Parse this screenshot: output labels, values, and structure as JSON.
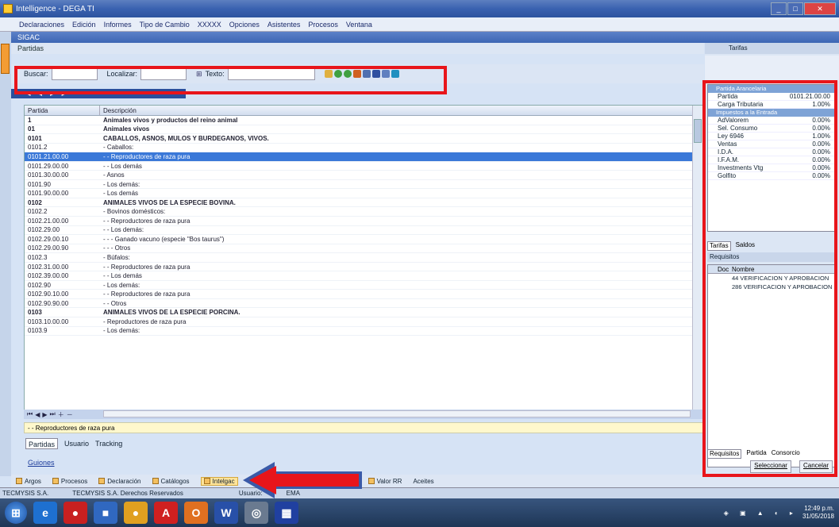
{
  "window": {
    "title": "Intelligence - DEGA TI"
  },
  "menu": [
    "Declaraciones",
    "Edición",
    "Informes",
    "Tipo de Cambio",
    "XXXXX",
    "Opciones",
    "Asistentes",
    "Procesos",
    "Ventana"
  ],
  "doc_tab": "SIGAC",
  "panel_title": "Partidas",
  "search": {
    "buscar_label": "Buscar:",
    "localizar_label": "Localizar:",
    "texto_label": "Texto:"
  },
  "table": {
    "col_partida": "Partida",
    "col_desc": "Descripción",
    "rows": [
      {
        "code": "1",
        "desc": "Animales vivos y productos del reino animal",
        "bold": true
      },
      {
        "code": "01",
        "desc": "Animales vivos",
        "bold": true
      },
      {
        "code": "0101",
        "desc": "CABALLOS, ASNOS, MULOS Y BURDEGANOS, VIVOS.",
        "bold": true
      },
      {
        "code": "0101.2",
        "desc": "- Caballos:"
      },
      {
        "code": "0101.21.00.00",
        "desc": "- - Reproductores de raza pura",
        "sel": true
      },
      {
        "code": "0101.29.00.00",
        "desc": "- - Los demás"
      },
      {
        "code": "0101.30.00.00",
        "desc": "- Asnos"
      },
      {
        "code": "0101.90",
        "desc": "- Los demás:"
      },
      {
        "code": "0101.90.00.00",
        "desc": "- Los demás"
      },
      {
        "code": "0102",
        "desc": "ANIMALES VIVOS DE LA ESPECIE BOVINA.",
        "bold": true
      },
      {
        "code": "0102.2",
        "desc": "- Bovinos domésticos:"
      },
      {
        "code": "0102.21.00.00",
        "desc": "- - Reproductores de raza pura"
      },
      {
        "code": "0102.29.00",
        "desc": "- - Los demás:"
      },
      {
        "code": "0102.29.00.10",
        "desc": "- - - Ganado vacuno (especie \"Bos taurus\")"
      },
      {
        "code": "0102.29.00.90",
        "desc": "- - - Otros"
      },
      {
        "code": "0102.3",
        "desc": "- Búfalos:"
      },
      {
        "code": "0102.31.00.00",
        "desc": "- - Reproductores de raza pura"
      },
      {
        "code": "0102.39.00.00",
        "desc": "- - Los demás"
      },
      {
        "code": "0102.90",
        "desc": "- Los demás:"
      },
      {
        "code": "0102.90.10.00",
        "desc": "- - Reproductores de raza pura"
      },
      {
        "code": "0102.90.90.00",
        "desc": "- - Otros"
      },
      {
        "code": "0103",
        "desc": "ANIMALES VIVOS DE LA ESPECIE PORCINA.",
        "bold": true
      },
      {
        "code": "0103.10.00.00",
        "desc": "- Reproductores de raza pura"
      },
      {
        "code": "0103.9",
        "desc": "- Los demás:"
      }
    ]
  },
  "desc_bar": "- - Reproductores de raza pura",
  "bottom_tabs": [
    "Partidas",
    "Usuario",
    "Tracking"
  ],
  "guion_link": "Guiones",
  "module_tabs": [
    "Argos",
    "Procesos",
    "Declaración",
    "Catálogos",
    "Intelgac",
    "Valor RR",
    "Aceites"
  ],
  "status": {
    "company": "TECMYSIS S.A.",
    "copyright": "TECMYSIS S.A. Derechos Reservados",
    "user": "Usuario:",
    "db": "EMA"
  },
  "right_panel": {
    "title": "Tarifas",
    "sec1": "Partida Arancelaria",
    "partida_label": "Partida",
    "partida_value": "0101.21.00.00",
    "carga_label": "Carga Tributaria",
    "carga_value": "1.00%",
    "sec2": "Impuestos a la Entrada",
    "items": [
      {
        "k": "AdValorem",
        "v": "0.00%"
      },
      {
        "k": "Sel. Consumo",
        "v": "0.00%"
      },
      {
        "k": "Ley 6946",
        "v": "1.00%"
      },
      {
        "k": "Ventas",
        "v": "0.00%"
      },
      {
        "k": "I.D.A.",
        "v": "0.00%"
      },
      {
        "k": "I.F.A.M.",
        "v": "0.00%"
      },
      {
        "k": "Investments Vtg",
        "v": "0.00%"
      },
      {
        "k": "Golfito",
        "v": "0.00%"
      }
    ],
    "tabs1": [
      "Tarifas",
      "Saldos"
    ],
    "requisitos_title": "Requisitos",
    "req_cols": [
      "Doc",
      "Nombre"
    ],
    "req_rows": [
      "44 VERIFICACION Y APROBACION",
      "286 VERIFICACION Y APROBACION"
    ],
    "tabs2": [
      "Requisitos",
      "Partida",
      "Consorcio"
    ],
    "btn_seleccionar": "Seleccionar",
    "btn_cancelar": "Cancelar"
  },
  "taskbar": {
    "time": "12:49 p.m.",
    "date": "31/05/2018"
  },
  "colors": {
    "annotation": "#e8151b",
    "accent": "#3a78d8"
  }
}
